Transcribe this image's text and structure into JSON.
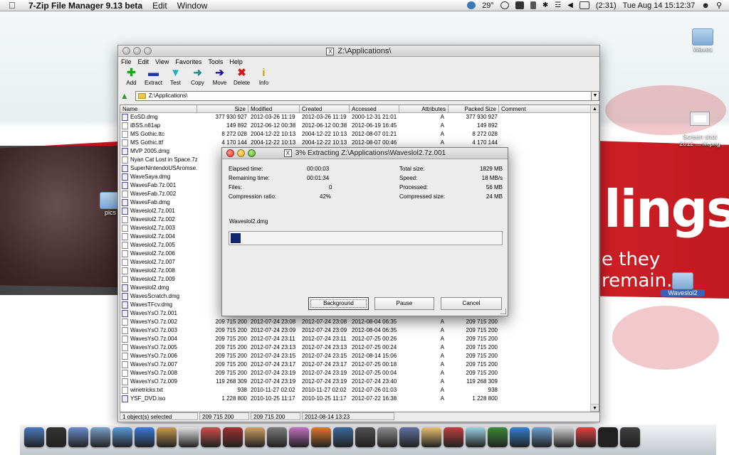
{
  "menubar": {
    "app_name": "7-Zip File Manager 9.13 beta",
    "items": [
      "Edit",
      "Window"
    ],
    "temperature": "29°",
    "battery": "(2:31)",
    "clock": "Tue Aug 14  15:12:37"
  },
  "desktop": {
    "icons": [
      {
        "label": "Waves"
      },
      {
        "label": "Screen shot\n2012 ... M.png"
      },
      {
        "label": "pics"
      },
      {
        "label": "Waveslol2"
      }
    ],
    "wallpaper_text_1": "lings",
    "wallpaper_text_2": "e they remain."
  },
  "window": {
    "title": "Z:\\Applications\\",
    "menus": [
      "File",
      "Edit",
      "View",
      "Favorites",
      "Tools",
      "Help"
    ],
    "toolbar": [
      {
        "label": "Add",
        "icon": "plus-icon",
        "color": "#1aa51a"
      },
      {
        "label": "Extract",
        "icon": "minus-icon",
        "color": "#1a3aa5"
      },
      {
        "label": "Test",
        "icon": "check-icon",
        "color": "#1ab0c0"
      },
      {
        "label": "Copy",
        "icon": "double-arrow-icon",
        "color": "#1a8a8a"
      },
      {
        "label": "Move",
        "icon": "arrow-right-icon",
        "color": "#1a1a90"
      },
      {
        "label": "Delete",
        "icon": "x-icon",
        "color": "#d01a1a"
      },
      {
        "label": "Info",
        "icon": "info-icon",
        "color": "#c8a000"
      }
    ],
    "address": "Z:\\Applications\\",
    "columns": [
      "Name",
      "Size",
      "Modified",
      "Created",
      "Accessed",
      "Attributes",
      "Packed Size",
      "Comment"
    ],
    "rows": [
      {
        "name": "EoSD.dmg",
        "size": "377 930 927",
        "modified": "2012-03-26 11:19",
        "created": "2012-03-26 11:19",
        "accessed": "2000-12-31 21:01",
        "attr": "A",
        "packed": "377 930 927",
        "type": "dmg"
      },
      {
        "name": "iBSS.n81ap",
        "size": "149 892",
        "modified": "2012-06-12 00:38",
        "created": "2012-06-12 00:38",
        "accessed": "2012-06-19 16:45",
        "attr": "A",
        "packed": "149 892",
        "type": "file"
      },
      {
        "name": "MS Gothic.ttc",
        "size": "8 272 028",
        "modified": "2004-12-22 10:13",
        "created": "2004-12-22 10:13",
        "accessed": "2012-08-07 01:21",
        "attr": "A",
        "packed": "8 272 028",
        "type": "file"
      },
      {
        "name": "MS Gothic.ttf",
        "size": "4 170 144",
        "modified": "2004-12-22 10:13",
        "created": "2004-12-22 10:13",
        "accessed": "2012-08-07 00:46",
        "attr": "A",
        "packed": "4 170 144",
        "type": "file"
      },
      {
        "name": "MVP 2005.dmg",
        "size": "1 36",
        "modified": "",
        "created": "",
        "accessed": "",
        "attr": "",
        "packed": "",
        "type": "dmg"
      },
      {
        "name": "Nyan Cat Lost in Space.7z",
        "size": "",
        "modified": "",
        "created": "",
        "accessed": "",
        "attr": "",
        "packed": "",
        "type": "file"
      },
      {
        "name": "SuperNintendoUSAromse...",
        "size": "68",
        "modified": "",
        "created": "",
        "accessed": "",
        "attr": "",
        "packed": "",
        "type": "dmg"
      },
      {
        "name": "WaveSaya.dmg",
        "size": "40",
        "modified": "",
        "created": "",
        "accessed": "",
        "attr": "",
        "packed": "",
        "type": "dmg"
      },
      {
        "name": "WavesFab.7z.001",
        "size": "16",
        "modified": "",
        "created": "",
        "accessed": "",
        "attr": "",
        "packed": "",
        "type": "dmg"
      },
      {
        "name": "WavesFab.7z.002",
        "size": "15",
        "modified": "",
        "created": "",
        "accessed": "",
        "attr": "",
        "packed": "",
        "type": "file"
      },
      {
        "name": "WavesFab.dmg",
        "size": "31",
        "modified": "",
        "created": "",
        "accessed": "",
        "attr": "",
        "packed": "",
        "type": "dmg"
      },
      {
        "name": "Waveslol2.7z.001",
        "size": "20",
        "modified": "",
        "created": "",
        "accessed": "",
        "attr": "",
        "packed": "",
        "type": "dmg"
      },
      {
        "name": "Waveslol2.7z.002",
        "size": "20",
        "modified": "",
        "created": "",
        "accessed": "",
        "attr": "",
        "packed": "",
        "type": "file"
      },
      {
        "name": "Waveslol2.7z.003",
        "size": "20",
        "modified": "",
        "created": "",
        "accessed": "",
        "attr": "",
        "packed": "",
        "type": "file"
      },
      {
        "name": "Waveslol2.7z.004",
        "size": "20",
        "modified": "",
        "created": "",
        "accessed": "",
        "attr": "",
        "packed": "",
        "type": "file"
      },
      {
        "name": "Waveslol2.7z.005",
        "size": "20",
        "modified": "",
        "created": "",
        "accessed": "",
        "attr": "",
        "packed": "",
        "type": "file"
      },
      {
        "name": "Waveslol2.7z.006",
        "size": "20",
        "modified": "",
        "created": "",
        "accessed": "",
        "attr": "",
        "packed": "",
        "type": "file"
      },
      {
        "name": "Waveslol2.7z.007",
        "size": "20",
        "modified": "",
        "created": "",
        "accessed": "",
        "attr": "",
        "packed": "",
        "type": "file"
      },
      {
        "name": "Waveslol2.7z.008",
        "size": "20",
        "modified": "",
        "created": "",
        "accessed": "",
        "attr": "",
        "packed": "",
        "type": "file"
      },
      {
        "name": "Waveslol2.7z.009",
        "size": "13",
        "modified": "",
        "created": "",
        "accessed": "",
        "attr": "",
        "packed": "",
        "type": "file"
      },
      {
        "name": "Waveslol2.dmg",
        "size": "1 91",
        "modified": "",
        "created": "",
        "accessed": "",
        "attr": "",
        "packed": "",
        "type": "dmg"
      },
      {
        "name": "WavesScratch.dmg",
        "size": "60",
        "modified": "",
        "created": "",
        "accessed": "",
        "attr": "",
        "packed": "",
        "type": "dmg"
      },
      {
        "name": "WavesTFcv.dmg",
        "size": "37",
        "modified": "",
        "created": "",
        "accessed": "",
        "attr": "",
        "packed": "",
        "type": "dmg"
      },
      {
        "name": "WavesYsO.7z.001",
        "size": "20",
        "modified": "",
        "created": "",
        "accessed": "",
        "attr": "",
        "packed": "",
        "type": "dmg"
      },
      {
        "name": "WavesYsO.7z.002",
        "size": "209 715 200",
        "modified": "2012-07-24 23:08",
        "created": "2012-07-24 23:08",
        "accessed": "2012-08-04 06:35",
        "attr": "A",
        "packed": "209 715 200",
        "type": "file"
      },
      {
        "name": "WavesYsO.7z.003",
        "size": "209 715 200",
        "modified": "2012-07-24 23:09",
        "created": "2012-07-24 23:09",
        "accessed": "2012-08-04 06:35",
        "attr": "A",
        "packed": "209 715 200",
        "type": "file"
      },
      {
        "name": "WavesYsO.7z.004",
        "size": "209 715 200",
        "modified": "2012-07-24 23:11",
        "created": "2012-07-24 23:11",
        "accessed": "2012-07-25 00:26",
        "attr": "A",
        "packed": "209 715 200",
        "type": "file"
      },
      {
        "name": "WavesYsO.7z.005",
        "size": "209 715 200",
        "modified": "2012-07-24 23:13",
        "created": "2012-07-24 23:13",
        "accessed": "2012-07-25 00:24",
        "attr": "A",
        "packed": "209 715 200",
        "type": "file"
      },
      {
        "name": "WavesYsO.7z.006",
        "size": "209 715 200",
        "modified": "2012-07-24 23:15",
        "created": "2012-07-24 23:15",
        "accessed": "2012-08-14 15:06",
        "attr": "A",
        "packed": "209 715 200",
        "type": "file"
      },
      {
        "name": "WavesYsO.7z.007",
        "size": "209 715 200",
        "modified": "2012-07-24 23:17",
        "created": "2012-07-24 23:17",
        "accessed": "2012-07-25 00:18",
        "attr": "A",
        "packed": "209 715 200",
        "type": "file"
      },
      {
        "name": "WavesYsO.7z.008",
        "size": "209 715 200",
        "modified": "2012-07-24 23:19",
        "created": "2012-07-24 23:19",
        "accessed": "2012-07-25 00:04",
        "attr": "A",
        "packed": "209 715 200",
        "type": "file"
      },
      {
        "name": "WavesYsO.7z.009",
        "size": "119 268 309",
        "modified": "2012-07-24 23:19",
        "created": "2012-07-24 23:19",
        "accessed": "2012-07-24 23:40",
        "attr": "A",
        "packed": "119 268 309",
        "type": "file"
      },
      {
        "name": "winetricks.txt",
        "size": "938",
        "modified": "2010-11-27 02:02",
        "created": "2010-11-27 02:02",
        "accessed": "2012-07-26 01:03",
        "attr": "A",
        "packed": "938",
        "type": "file"
      },
      {
        "name": "YSF_DVD.iso",
        "size": "1 228 800",
        "modified": "2010-10-25 11:17",
        "created": "2010-10-25 11:17",
        "accessed": "2012-07-22 16:38",
        "attr": "A",
        "packed": "1 228 800",
        "type": "dmg"
      }
    ],
    "status": {
      "selected": "1 object(s) selected",
      "size": "209 715 200",
      "packed": "209 715 200",
      "date": "2012-08-14 13:23"
    }
  },
  "dialog": {
    "title": "3% Extracting Z:\\Applications\\Waveslol2.7z.001",
    "progress_percent": 3,
    "stats_left": [
      {
        "label": "Elapsed time:",
        "value": "00:00:03"
      },
      {
        "label": "Remaining time:",
        "value": "00:01:34"
      },
      {
        "label": "Files:",
        "value": "0"
      },
      {
        "label": "Compression ratio:",
        "value": "42%"
      }
    ],
    "stats_right": [
      {
        "label": "Total size:",
        "value": "1829 MB"
      },
      {
        "label": "Speed:",
        "value": "18 MB/s"
      },
      {
        "label": "Processed:",
        "value": "56 MB"
      },
      {
        "label": "Compressed size:",
        "value": "24 MB"
      }
    ],
    "current_file": "Waveslol2.dmg",
    "buttons": {
      "background": "Background",
      "pause": "Pause",
      "cancel": "Cancel"
    }
  },
  "dock": {
    "colors": [
      "#4a7ac0",
      "#333",
      "#6a8acd",
      "#7aa0c8",
      "#5a9ad8",
      "#3a7ad8",
      "#c89a50",
      "#e0e0e0",
      "#c8504a",
      "#a03030",
      "#d0a060",
      "#7a7a7a",
      "#c070c0",
      "#e0782a",
      "#3a6a9a",
      "#505050",
      "#8a8a8a",
      "#6070a0",
      "#e8c070",
      "#c04040",
      "#9ad0e0",
      "#3a8a3a",
      "#3080d0",
      "#6aa0d0",
      "#d0d0d0",
      "#e04040",
      "#202020",
      "#404040"
    ]
  }
}
